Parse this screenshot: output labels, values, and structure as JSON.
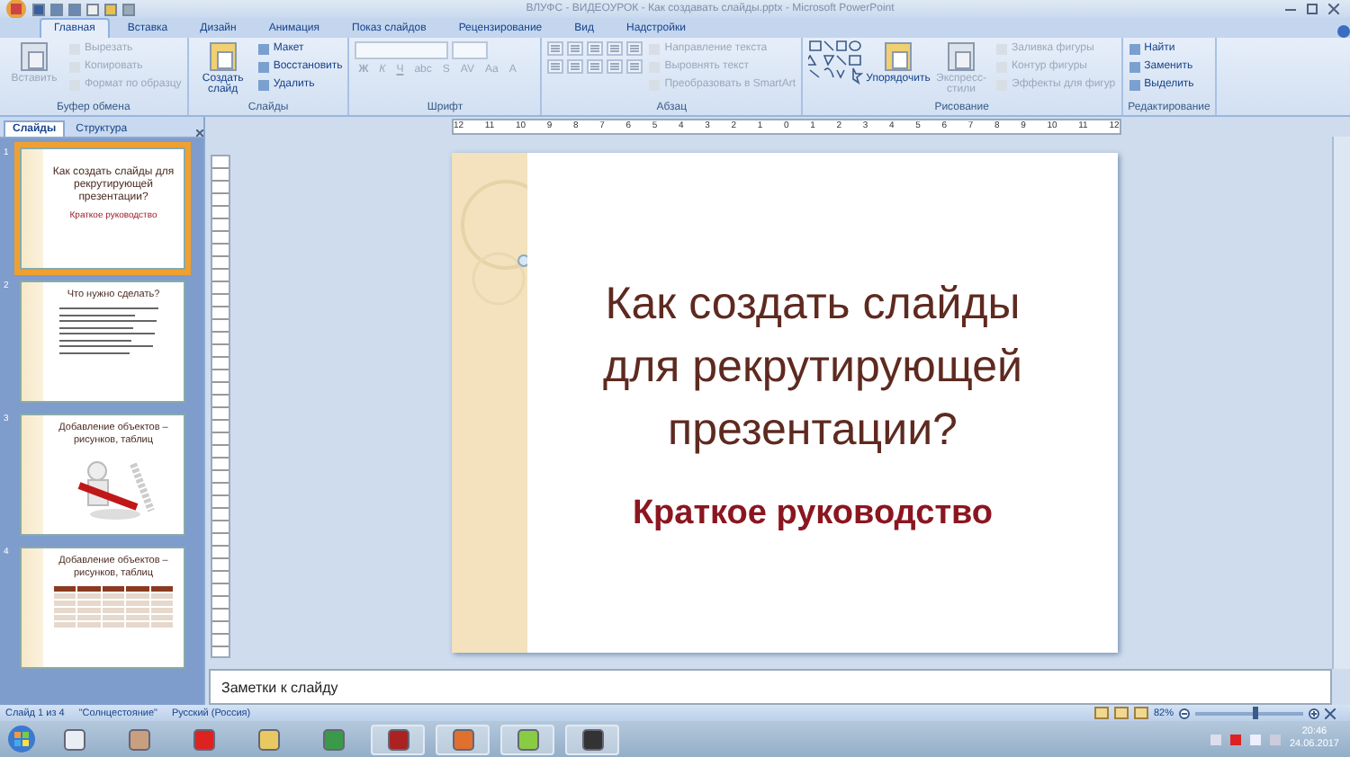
{
  "window": {
    "title": "ВЛУФС - ВИДЕОУРОК - Как создавать слайды.pptx - Microsoft PowerPoint"
  },
  "tabs": [
    {
      "label": "Главная",
      "selected": true
    },
    {
      "label": "Вставка",
      "selected": false
    },
    {
      "label": "Дизайн",
      "selected": false
    },
    {
      "label": "Анимация",
      "selected": false
    },
    {
      "label": "Показ слайдов",
      "selected": false
    },
    {
      "label": "Рецензирование",
      "selected": false
    },
    {
      "label": "Вид",
      "selected": false
    },
    {
      "label": "Надстройки",
      "selected": false
    }
  ],
  "ribbon_groups": [
    {
      "title": "Буфер обмена",
      "kind": "items",
      "items": [
        {
          "kind": "large",
          "label": "Вставить",
          "disabled": true
        },
        {
          "kind": "small",
          "label": "Вырезать",
          "disabled": true
        },
        {
          "kind": "small",
          "label": "Копировать",
          "disabled": true
        },
        {
          "kind": "small",
          "label": "Формат по образцу",
          "disabled": true
        }
      ]
    },
    {
      "title": "Слайды",
      "kind": "items",
      "items": [
        {
          "kind": "large",
          "label": "Создать слайд",
          "disabled": false
        },
        {
          "kind": "small",
          "label": "Макет",
          "disabled": false
        },
        {
          "kind": "small",
          "label": "Восстановить",
          "disabled": false
        },
        {
          "kind": "small",
          "label": "Удалить",
          "disabled": false
        }
      ]
    },
    {
      "title": "Шрифт",
      "kind": "font",
      "format_buttons": [
        "Ж",
        "К",
        "Ч",
        "abc",
        "S",
        "AV",
        "Aa",
        "A"
      ]
    },
    {
      "title": "Абзац",
      "kind": "paragraph",
      "items": [
        {
          "kind": "small",
          "label": "Направление текста",
          "disabled": true
        },
        {
          "kind": "small",
          "label": "Выровнять текст",
          "disabled": true
        },
        {
          "kind": "small",
          "label": "Преобразовать в SmartArt",
          "disabled": true
        }
      ]
    },
    {
      "title": "Рисование",
      "kind": "drawing",
      "items": [
        {
          "kind": "large",
          "label": "Упорядочить",
          "disabled": false
        },
        {
          "kind": "large",
          "label": "Экспресс-стили",
          "disabled": true
        },
        {
          "kind": "small",
          "label": "Заливка фигуры",
          "disabled": true
        },
        {
          "kind": "small",
          "label": "Контур фигуры",
          "disabled": true
        },
        {
          "kind": "small",
          "label": "Эффекты для фигур",
          "disabled": true
        }
      ]
    },
    {
      "title": "Редактирование",
      "kind": "items",
      "items": [
        {
          "kind": "small",
          "label": "Найти",
          "disabled": false
        },
        {
          "kind": "small",
          "label": "Заменить",
          "disabled": false
        },
        {
          "kind": "small",
          "label": "Выделить",
          "disabled": false
        }
      ]
    }
  ],
  "pane_tabs": [
    {
      "label": "Слайды",
      "selected": true
    },
    {
      "label": "Структура",
      "selected": false
    }
  ],
  "thumbnails": [
    {
      "number": "1",
      "selected": true,
      "kind": "title",
      "title": "Как создать слайды для рекрутирующей презентации?",
      "subtitle": "Краткое руководство"
    },
    {
      "number": "2",
      "selected": false,
      "kind": "list",
      "title": "Что нужно сделать?"
    },
    {
      "number": "3",
      "selected": false,
      "kind": "picture",
      "title": "Добавление объектов – рисунков, таблиц"
    },
    {
      "number": "4",
      "selected": false,
      "kind": "table",
      "title": "Добавление объектов – рисунков, таблиц"
    }
  ],
  "ruler_labels": [
    "12",
    "11",
    "10",
    "9",
    "8",
    "7",
    "6",
    "5",
    "4",
    "3",
    "2",
    "1",
    "0",
    "1",
    "2",
    "3",
    "4",
    "5",
    "6",
    "7",
    "8",
    "9",
    "10",
    "11",
    "12"
  ],
  "slide": {
    "title": "Как создать слайды для рекрутирующей презентации?",
    "subtitle": "Краткое руководство"
  },
  "notes": {
    "placeholder": "Заметки к слайду"
  },
  "status_bar": {
    "items": [
      "Слайд 1 из 4",
      "\"Солнцестояние\"",
      "Русский (Россия)"
    ],
    "zoom": "82%",
    "zoom_slider": {
      "level": 0.55
    }
  },
  "taskbar": {
    "time": "20:46",
    "date": "24.06.2017"
  }
}
